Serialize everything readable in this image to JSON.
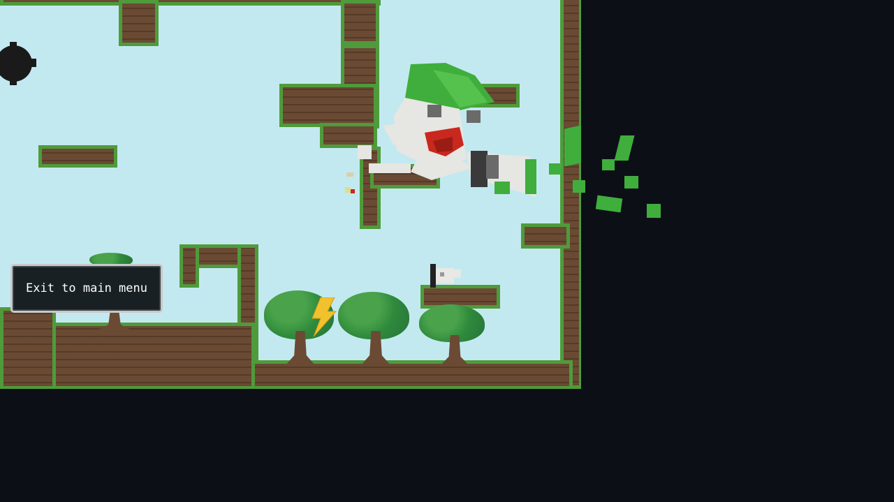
{
  "menu": {
    "exit_label": "Exit to main menu"
  },
  "colors": {
    "sky": "#c3e9f0",
    "void": "#0c1016",
    "grass": "#4f9b3b",
    "dirt": "#6a4a33",
    "player_cap": "#3fae3c",
    "player_body": "#e6e6e2",
    "player_mouth": "#c8281e",
    "bolt": "#f2c12e"
  },
  "icons": {
    "power_up": "lightning-bolt-icon",
    "hazard": "black-spike-ball-icon"
  }
}
